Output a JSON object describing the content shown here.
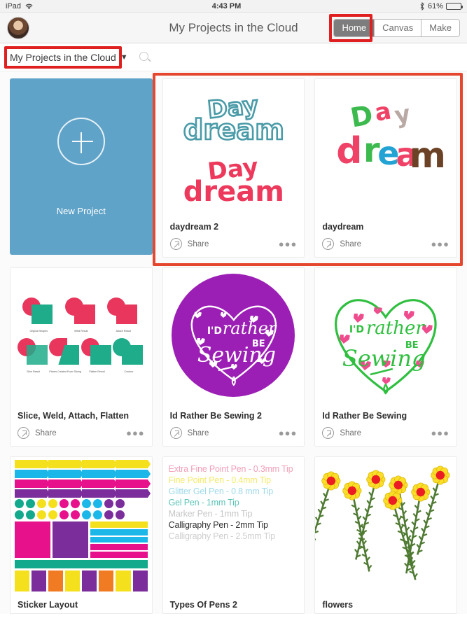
{
  "status_bar": {
    "device": "iPad",
    "wifi_icon": "wifi-icon",
    "time": "4:43 PM",
    "bluetooth_icon": "bluetooth-icon",
    "battery_text": "61%",
    "battery_percent": 61
  },
  "nav": {
    "title": "My Projects in the Cloud",
    "avatar_name": "user-avatar",
    "segments": [
      {
        "label": "Home",
        "active": true,
        "highlighted": true
      },
      {
        "label": "Canvas",
        "active": false,
        "highlighted": false
      },
      {
        "label": "Make",
        "active": false,
        "highlighted": false
      }
    ]
  },
  "filter_bar": {
    "dropdown_value": "My Projects in the Cloud",
    "dropdown_caret": "▼",
    "dropdown_highlighted": true,
    "search_icon": "search-icon",
    "search_placeholder": ""
  },
  "highlights": {
    "color": "#e02020",
    "row1_color": "#e5462e"
  },
  "new_project": {
    "label": "New Project",
    "icon": "plus-circle-icon",
    "background": "#60a3c8"
  },
  "share_label": "Share",
  "more_label": "●●●",
  "projects": [
    {
      "title": "daydream 2",
      "share": "Share",
      "art": "daydream-outline-and-fill",
      "colors": {
        "outline": "#4a9ba8",
        "fill": "#ed3a5c"
      },
      "highlighted": true
    },
    {
      "title": "daydream",
      "share": "Share",
      "art": "daydream-multicolor",
      "colors": {
        "d": "#ef4266",
        "r": "#3dba4e",
        "e": "#22a3d4",
        "a": "#ef4266",
        "m": "#6b4226",
        "day_green": "#3dba4e",
        "day_pink": "#ef4266",
        "day_gray": "#b9a9a4"
      },
      "highlighted": true
    },
    {
      "title": "Slice, Weld, Attach, Flatten",
      "share": "Share",
      "art": "shape-operations-demo",
      "colors": {
        "circle": "#e8365d",
        "square": "#1eac8a"
      },
      "demo_labels": [
        "Original Shapes",
        "Weld Result",
        "Attach Result",
        "Slice Result",
        "Pieces Created From Slicing",
        "Flatten Result",
        "Contour"
      ],
      "highlighted": false
    },
    {
      "title": "Id Rather Be Sewing 2",
      "share": "Share",
      "art": "sewing-heart-purple",
      "art_text": [
        "I'D",
        "rather",
        "BE",
        "Sewing"
      ],
      "colors": {
        "background": "#9c1fb5",
        "ink": "#ffffff"
      },
      "highlighted": false
    },
    {
      "title": "Id Rather Be Sewing",
      "share": "Share",
      "art": "sewing-heart-green",
      "art_text": [
        "I'D",
        "rather",
        "BE",
        "Sewing"
      ],
      "colors": {
        "ink": "#2fbf3f",
        "hearts": "#ef4c8e"
      },
      "highlighted": false
    },
    {
      "title": "Sticker Layout",
      "share": "",
      "art": "sticker-sheet",
      "colors": {
        "yellow": "#f5e01e",
        "cyan": "#1bb7e8",
        "magenta": "#e8118c",
        "purple": "#7b2d9c",
        "teal": "#12a98c",
        "orange": "#f07b23"
      },
      "highlighted": false
    },
    {
      "title": "Types Of Pens 2",
      "share": "",
      "art": "pen-types-list",
      "pen_lines": [
        {
          "text": "Extra Fine Point Pen - 0.3mm Tip",
          "color": "#f2a0b8"
        },
        {
          "text": "Fine Point Pen - 0.4mm Tip",
          "color": "#f5ea6a"
        },
        {
          "text": "Glitter Gel Pen - 0.8 mm Tip",
          "color": "#9fd9e8"
        },
        {
          "text": "Gel Pen - 1mm Tip",
          "color": "#5bc4b8"
        },
        {
          "text": "Marker Pen - 1mm Tip",
          "color": "#c6c6c6"
        },
        {
          "text": "Calligraphy Pen - 2mm Tip",
          "color": "#2f2f2f"
        },
        {
          "text": "Calligraphy Pen - 2.5mm Tip",
          "color": "#cfcfcf"
        }
      ],
      "highlighted": false
    },
    {
      "title": "flowers",
      "share": "",
      "art": "flowers-row",
      "colors": {
        "petal": "#fbdd2a",
        "center": "#ec1c24",
        "stem": "#4f7a32"
      },
      "flower_count": 7,
      "highlighted": false
    }
  ]
}
